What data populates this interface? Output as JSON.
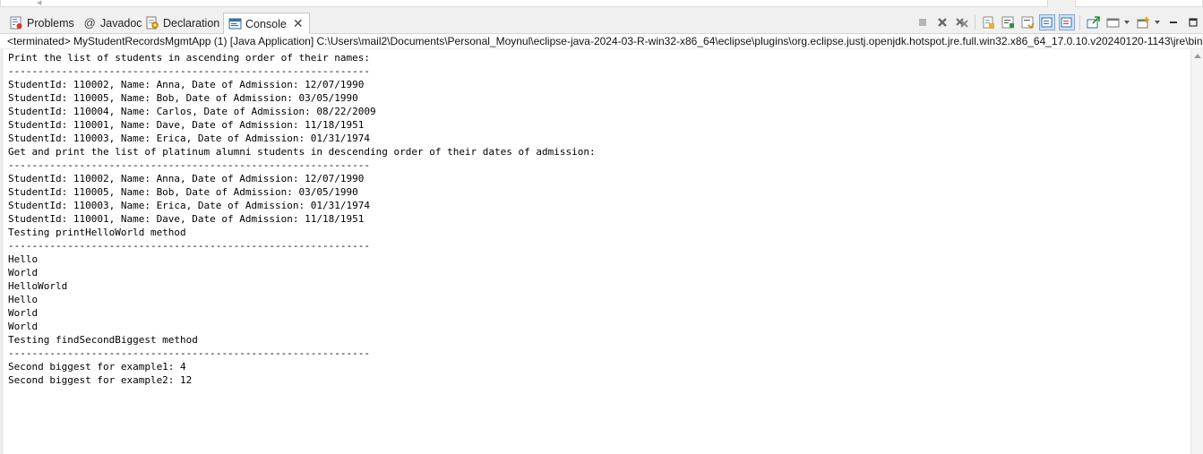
{
  "tabs": [
    {
      "label": "Problems",
      "icon": "problems-icon",
      "active": false
    },
    {
      "label": "Javadoc",
      "icon": "at-icon",
      "active": false
    },
    {
      "label": "Declaration",
      "icon": "declaration-icon",
      "active": false
    },
    {
      "label": "Console",
      "icon": "console-icon",
      "active": true
    }
  ],
  "console": {
    "status_line": "<terminated> MyStudentRecordsMgmtApp (1) [Java Application] C:\\Users\\mail2\\Documents\\Personal_Moynul\\eclipse-java-2024-03-R-win32-x86_64\\eclipse\\plugins\\org.eclipse.justj.openjdk.hotspot.jre.full.win32.x86_64_17.0.10.v20240120-1143\\jre\\bin\\j",
    "lines": [
      "Print the list of students in ascending order of their names:",
      "-------------------------------------------------------------",
      "StudentId: 110002, Name: Anna, Date of Admission: 12/07/1990",
      "StudentId: 110005, Name: Bob, Date of Admission: 03/05/1990",
      "StudentId: 110004, Name: Carlos, Date of Admission: 08/22/2009",
      "StudentId: 110001, Name: Dave, Date of Admission: 11/18/1951",
      "StudentId: 110003, Name: Erica, Date of Admission: 01/31/1974",
      "Get and print the list of platinum alumni students in descending order of their dates of admission:",
      "-------------------------------------------------------------",
      "StudentId: 110002, Name: Anna, Date of Admission: 12/07/1990",
      "StudentId: 110005, Name: Bob, Date of Admission: 03/05/1990",
      "StudentId: 110003, Name: Erica, Date of Admission: 01/31/1974",
      "StudentId: 110001, Name: Dave, Date of Admission: 11/18/1951",
      "Testing printHelloWorld method",
      "-------------------------------------------------------------",
      "Hello",
      "World",
      "HelloWorld",
      "Hello",
      "World",
      "World",
      "Testing findSecondBiggest method",
      "-------------------------------------------------------------",
      "Second biggest for example1: 4",
      "Second biggest for example2: 12"
    ]
  },
  "toolbar": {
    "icons": [
      "terminate-icon",
      "remove-launch-icon",
      "remove-all-terminated-icon",
      "scroll-lock-icon",
      "word-wrap-icon",
      "show-on-stdout-icon",
      "show-on-stderr-icon",
      "pin-console-icon",
      "display-console-icon",
      "open-console-icon",
      "minimize-icon",
      "maximize-icon"
    ]
  }
}
